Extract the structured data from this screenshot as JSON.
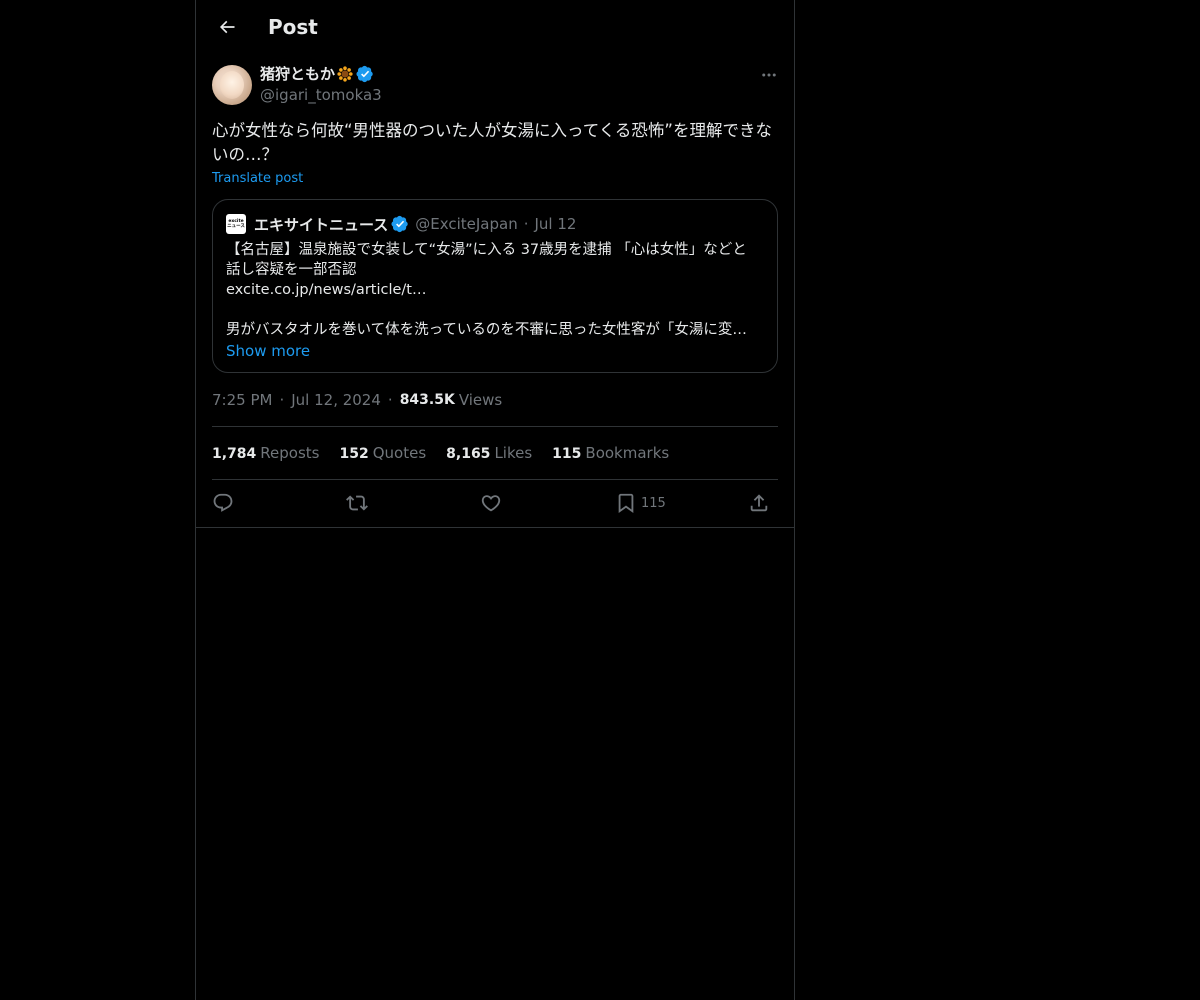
{
  "header": {
    "title": "Post"
  },
  "author": {
    "name": "猪狩ともか",
    "handle": "@igari_tomoka3"
  },
  "post": {
    "text": "心が女性なら何故“男性器のついた人が女湯に入ってくる恐怖”を理解できないの…？",
    "translate_label": "Translate post"
  },
  "quote": {
    "logo_text": [
      "excite",
      "ニュース"
    ],
    "name": "エキサイトニュース",
    "handle": "@ExciteJapan",
    "date": "Jul 12",
    "lines": [
      "【名古屋】温泉施設で女装して“女湯”に入る 37歳男を逮捕 「心は女性」などと",
      "話し容疑を一部否認",
      "excite.co.jp/news/article/t…",
      "",
      "男がバスタオルを巻いて体を洗っているのを不審に思った女性客が「女湯に変…"
    ],
    "show_more": "Show more"
  },
  "meta": {
    "time": "7:25 PM",
    "date": "Jul 12, 2024",
    "views_count": "843.5K",
    "views_label": "Views"
  },
  "stats": {
    "reposts_count": "1,784",
    "reposts_label": "Reposts",
    "quotes_count": "152",
    "quotes_label": "Quotes",
    "likes_count": "8,165",
    "likes_label": "Likes",
    "bookmarks_count": "115",
    "bookmarks_label": "Bookmarks"
  },
  "actions": {
    "bookmark_count": "115",
    "icons": [
      "reply-icon",
      "repost-icon",
      "like-icon",
      "bookmark-icon",
      "share-icon"
    ]
  },
  "colors": {
    "background": "#000000",
    "text": "#e7e9ea",
    "secondary": "#71767b",
    "accent": "#1d9bf0",
    "border": "#2f3336"
  }
}
